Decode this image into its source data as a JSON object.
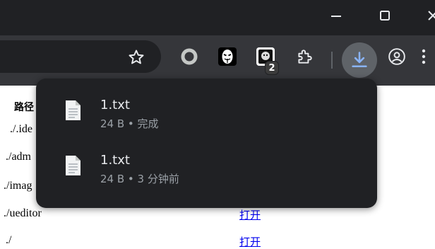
{
  "window_controls": {
    "minimize": "minimize-icon",
    "maximize": "maximize-icon",
    "close": "close-icon"
  },
  "toolbar": {
    "bookmark_icon": "star-icon",
    "extensions": [
      {
        "name": "circle-extension-icon"
      },
      {
        "name": "mask-extension-icon"
      },
      {
        "name": "face-extension-icon",
        "badge": "2"
      },
      {
        "name": "puzzle-extensions-icon"
      }
    ],
    "download_icon": "download-icon",
    "profile_icon": "profile-icon",
    "menu_icon": "kebab-menu-icon"
  },
  "page": {
    "column_header": "路径",
    "rows": [
      "./.ide",
      "./adm",
      "./imag",
      "./ueditor",
      "./"
    ],
    "action_link": "打开"
  },
  "downloads": [
    {
      "file_name": "1.txt",
      "meta": "24 B • 完成"
    },
    {
      "file_name": "1.txt",
      "meta": "24 B • 3 分钟前"
    }
  ],
  "colors": {
    "titlebar": "#202124",
    "toolbar": "#35363a",
    "bubble": "#202124",
    "accent": "#8ab4f8",
    "link": "#0000ee"
  }
}
